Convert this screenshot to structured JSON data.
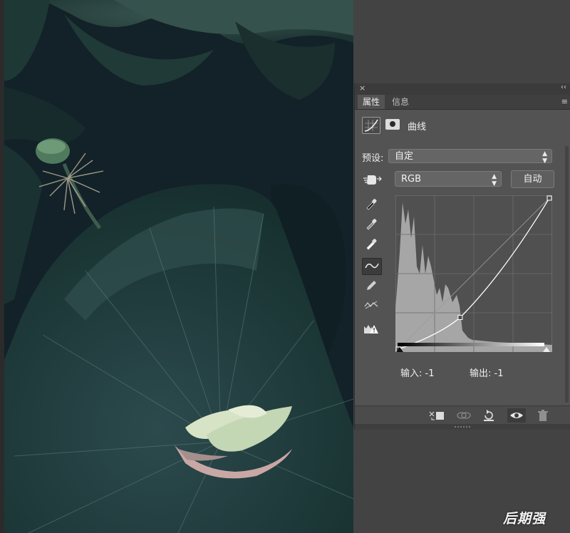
{
  "panel": {
    "tabs": [
      {
        "label": "属性"
      },
      {
        "label": "信息"
      }
    ],
    "close_glyph": "×",
    "collapse_glyph": "‹‹",
    "menu_glyph": "≡"
  },
  "adjustment": {
    "title": "曲线",
    "preset_label": "预设:",
    "preset_value": "自定",
    "channel_value": "RGB",
    "auto_label": "自动",
    "input_label": "输入: -1",
    "output_label": "输出: -1",
    "curve_points": [
      {
        "in": 0,
        "out": 0
      },
      {
        "in": 41,
        "out": 21
      },
      {
        "in": 100,
        "out": 100
      }
    ]
  },
  "tools": [
    {
      "icon": "on-image-adjust-icon"
    },
    {
      "icon": "black-point-eyedropper-icon"
    },
    {
      "icon": "gray-point-eyedropper-icon"
    },
    {
      "icon": "white-point-eyedropper-icon"
    },
    {
      "icon": "curve-point-tool-icon"
    },
    {
      "icon": "pencil-icon"
    },
    {
      "icon": "smooth-curve-icon"
    },
    {
      "icon": "clipping-warning-icon"
    }
  ],
  "footer_buttons": [
    {
      "icon": "clip-to-layer-icon"
    },
    {
      "icon": "view-previous-state-icon"
    },
    {
      "icon": "reset-icon"
    },
    {
      "icon": "visibility-icon"
    },
    {
      "icon": "trash-icon"
    }
  ],
  "colors": {
    "panel_bg": "#535353",
    "workspace_bg": "#434343",
    "curve": "#ffffff",
    "histogram": "#a6a6a6"
  },
  "watermark": "后期强"
}
